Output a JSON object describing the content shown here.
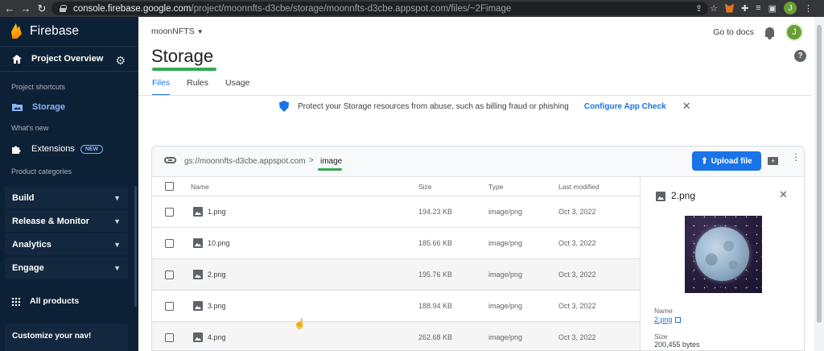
{
  "browser": {
    "back": "←",
    "forward": "→",
    "reload": "↻",
    "url_host": "console.firebase.google.com",
    "url_path": "/project/moonnfts-d3cbe/storage/moonnfts-d3cbe.appspot.com/files/~2Fimage",
    "profile_initial": "J"
  },
  "sidebar": {
    "brand": "Firebase",
    "overview_label": "Project Overview",
    "shortcuts_title": "Project shortcuts",
    "storage_label": "Storage",
    "whats_new_title": "What's new",
    "extensions_label": "Extensions",
    "new_badge": "NEW",
    "categories_title": "Product categories",
    "categories": [
      "Build",
      "Release & Monitor",
      "Analytics",
      "Engage"
    ],
    "all_products": "All products",
    "customize": "Customize your nav!"
  },
  "header": {
    "project": "moonNFTS",
    "go_to_docs": "Go to docs",
    "avatar_initial": "J",
    "help": "?"
  },
  "page": {
    "title": "Storage",
    "tabs": [
      "Files",
      "Rules",
      "Usage"
    ]
  },
  "banner": {
    "text": "Protect your Storage resources from abuse, such as billing fraud or phishing",
    "link": "Configure App Check",
    "close": "✕"
  },
  "files": {
    "bucket": "gs://moonnfts-d3cbe.appspot.com",
    "separator": ">",
    "folder": "image",
    "upload_label": "Upload file",
    "columns": {
      "name": "Name",
      "size": "Size",
      "type": "Type",
      "modified": "Last modified"
    },
    "rows": [
      {
        "name": "1.png",
        "size": "194.23 KB",
        "type": "image/png",
        "modified": "Oct 3, 2022"
      },
      {
        "name": "10.png",
        "size": "185.66 KB",
        "type": "image/png",
        "modified": "Oct 3, 2022"
      },
      {
        "name": "2.png",
        "size": "195.76 KB",
        "type": "image/png",
        "modified": "Oct 3, 2022"
      },
      {
        "name": "3.png",
        "size": "188.94 KB",
        "type": "image/png",
        "modified": "Oct 3, 2022"
      },
      {
        "name": "4.png",
        "size": "262.68 KB",
        "type": "image/png",
        "modified": "Oct 3, 2022"
      }
    ]
  },
  "detail": {
    "title": "2.png",
    "close": "✕",
    "name_label": "Name",
    "name_value": "2.png",
    "size_label": "Size",
    "size_value": "200,455 bytes"
  },
  "colors": {
    "sidebar_bg": "#0d2136",
    "accent_blue": "#1a73e8",
    "accent_green": "#34a853"
  }
}
